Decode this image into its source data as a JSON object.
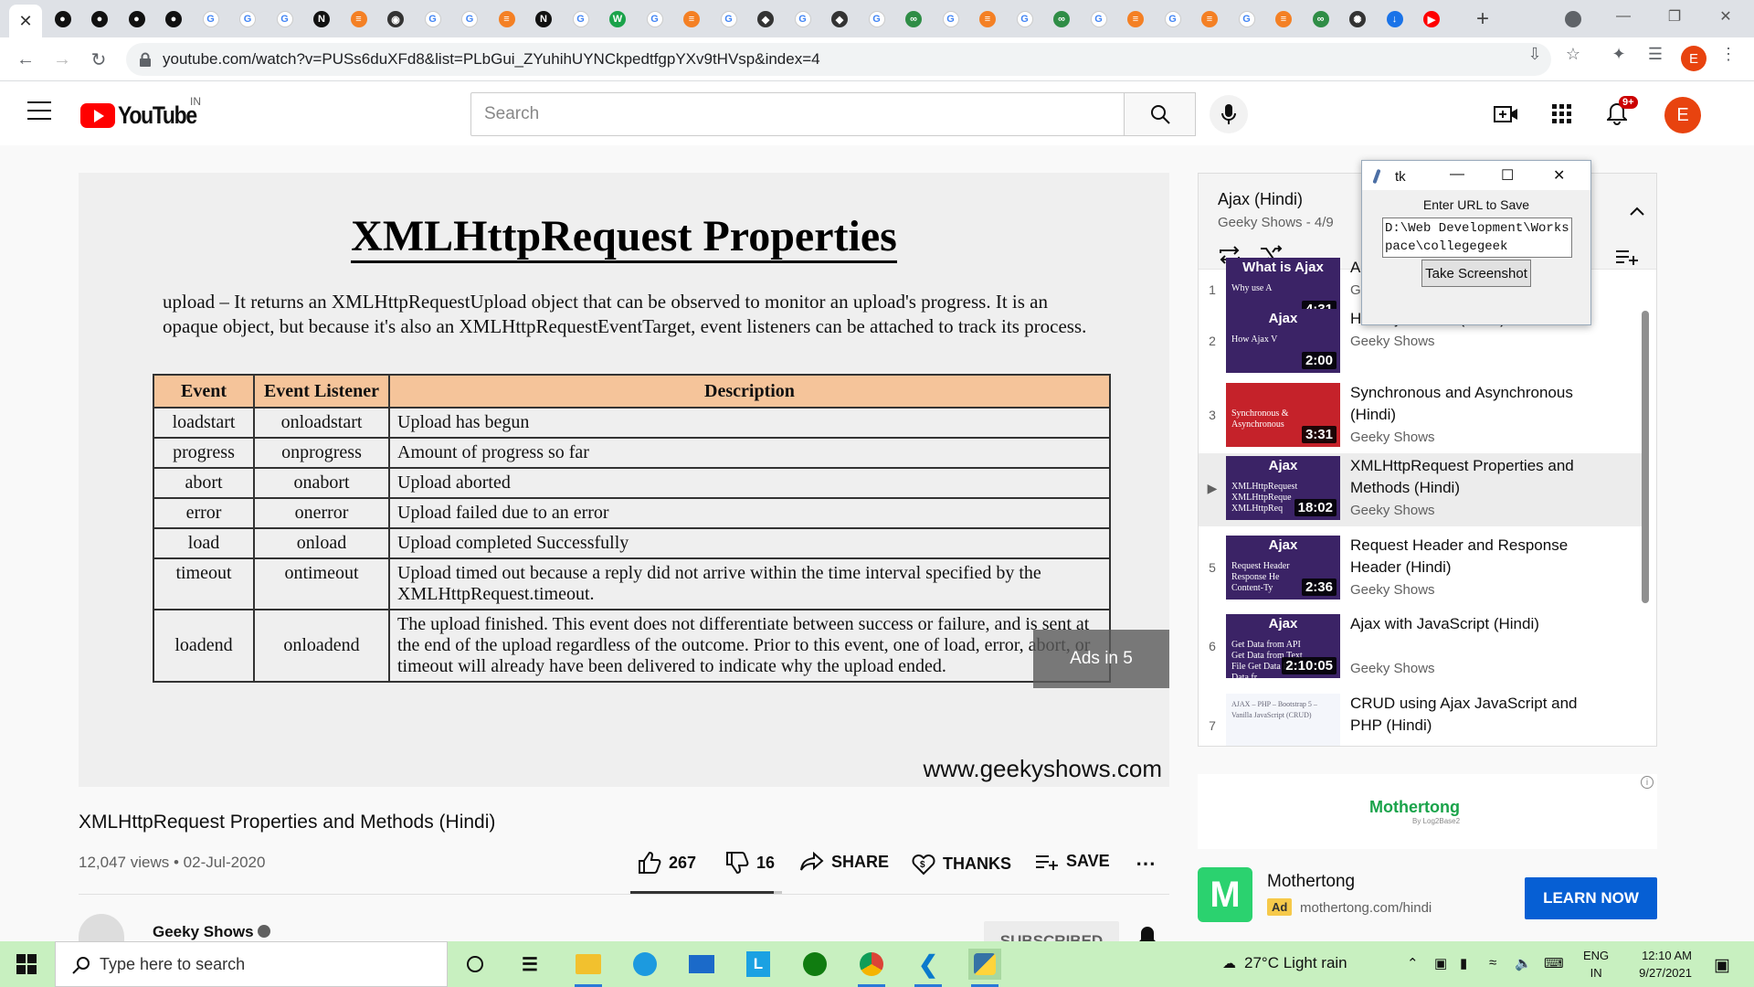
{
  "browser": {
    "tabs": [
      {
        "icon": "close-icon",
        "color": "#ffffff",
        "active": true
      },
      {
        "icon": "github-icon",
        "color": "#111111"
      },
      {
        "icon": "github-icon",
        "color": "#111111"
      },
      {
        "icon": "github-icon",
        "color": "#111111"
      },
      {
        "icon": "github-icon",
        "color": "#111111"
      },
      {
        "icon": "google-icon",
        "color": "#4285f4"
      },
      {
        "icon": "google-icon",
        "color": "#4285f4"
      },
      {
        "icon": "google-icon",
        "color": "#4285f4"
      },
      {
        "icon": "notion-icon",
        "color": "#111111"
      },
      {
        "icon": "stackoverflow-icon",
        "color": "#f48024"
      },
      {
        "icon": "web-icon",
        "color": "#333333"
      },
      {
        "icon": "google-icon",
        "color": "#4285f4"
      },
      {
        "icon": "google-icon",
        "color": "#4285f4"
      },
      {
        "icon": "stackoverflow-icon",
        "color": "#f48024"
      },
      {
        "icon": "notion-icon",
        "color": "#111111"
      },
      {
        "icon": "google-icon",
        "color": "#4285f4"
      },
      {
        "icon": "w-icon",
        "color": "#1aa34a"
      },
      {
        "icon": "google-icon",
        "color": "#4285f4"
      },
      {
        "icon": "stackoverflow-icon",
        "color": "#f48024"
      },
      {
        "icon": "google-icon",
        "color": "#4285f4"
      },
      {
        "icon": "diamond-icon",
        "color": "#333333"
      },
      {
        "icon": "google-icon",
        "color": "#4285f4"
      },
      {
        "icon": "diamond-icon",
        "color": "#333333"
      },
      {
        "icon": "google-icon",
        "color": "#4285f4"
      },
      {
        "icon": "gfg-icon",
        "color": "#2f8d46"
      },
      {
        "icon": "google-icon",
        "color": "#4285f4"
      },
      {
        "icon": "stackoverflow-icon",
        "color": "#f48024"
      },
      {
        "icon": "google-icon",
        "color": "#4285f4"
      },
      {
        "icon": "gfg-icon",
        "color": "#2f8d46"
      },
      {
        "icon": "google-icon",
        "color": "#4285f4"
      },
      {
        "icon": "stackoverflow-icon",
        "color": "#f48024"
      },
      {
        "icon": "google-icon",
        "color": "#4285f4"
      },
      {
        "icon": "stackoverflow-icon",
        "color": "#f48024"
      },
      {
        "icon": "google-icon",
        "color": "#4285f4"
      },
      {
        "icon": "stackoverflow-icon",
        "color": "#f48024"
      },
      {
        "icon": "gfg-icon",
        "color": "#2f8d46"
      },
      {
        "icon": "openai-icon",
        "color": "#333333"
      },
      {
        "icon": "download-icon",
        "color": "#1a73e8"
      },
      {
        "icon": "youtube-icon",
        "color": "#ff0000"
      }
    ],
    "url": "youtube.com/watch?v=PUSs6duXFd8&list=PLbGui_ZYuhihUYNCkpedtfgpYXv9tHVsp&index=4",
    "profile_initial": "E"
  },
  "header": {
    "logo_text": "YouTube",
    "region": "IN",
    "search_placeholder": "Search",
    "notification_count": "9+",
    "avatar_initial": "E"
  },
  "video": {
    "slide_title": "XMLHttpRequest Properties",
    "slide_paragraph": "upload – It returns an XMLHttpRequestUpload object that can be observed to monitor an upload's progress. It is an opaque object, but because it's also an XMLHttpRequestEventTarget, event listeners can be attached to track its process.",
    "table_headers": [
      "Event",
      "Event Listener",
      "Description"
    ],
    "table_rows": [
      [
        "loadstart",
        "onloadstart",
        "Upload has begun"
      ],
      [
        "progress",
        "onprogress",
        "Amount of progress so far"
      ],
      [
        "abort",
        "onabort",
        "Upload aborted"
      ],
      [
        "error",
        "onerror",
        "Upload failed due to an error"
      ],
      [
        "load",
        "onload",
        "Upload completed Successfully"
      ],
      [
        "timeout",
        "ontimeout",
        "Upload timed out because a reply did not arrive within the time interval specified by the XMLHttpRequest.timeout."
      ],
      [
        "loadend",
        "onloadend",
        "The upload finished. This event does not differentiate between success or failure, and is sent at the end of the upload regardless of the outcome. Prior to this event, one of load, error, abort, or timeout will already have been delivered to indicate why the upload ended."
      ]
    ],
    "ads_text": "Ads in 5",
    "watermark": "www.geekyshows.com",
    "title": "XMLHttpRequest Properties and Methods (Hindi)",
    "views": "12,047 views",
    "date": "02-Jul-2020",
    "likes": "267",
    "dislikes": "16",
    "like_ratio": 0.943,
    "share_label": "SHARE",
    "thanks_label": "THANKS",
    "save_label": "SAVE",
    "channel_name": "Geeky Shows",
    "subscribe_label": "SUBSCRIBED"
  },
  "playlist": {
    "title": "Ajax (Hindi)",
    "subtitle": "Geeky Shows - 4/9",
    "items": [
      {
        "num": "1",
        "title": "A",
        "channel": "G",
        "duration": "4:31",
        "thumb_head": "What is Ajax",
        "thumb_sub": "Why use A",
        "thumb_color": "#3b2366"
      },
      {
        "num": "2",
        "title": "How Ajax Work (Hindi)",
        "channel": "Geeky Shows",
        "duration": "2:00",
        "thumb_head": "Ajax",
        "thumb_sub": "How Ajax V",
        "thumb_color": "#3b2366"
      },
      {
        "num": "3",
        "title": "Synchronous and Asynchronous (Hindi)",
        "channel": "Geeky Shows",
        "duration": "3:31",
        "thumb_head": "",
        "thumb_sub": "Synchronous & Asynchronous",
        "thumb_color": "#c5222a"
      },
      {
        "num": "▶",
        "title": "XMLHttpRequest Properties and Methods (Hindi)",
        "channel": "Geeky Shows",
        "duration": "18:02",
        "thumb_head": "Ajax",
        "thumb_sub": "XMLHttpRequest XMLHttpReque XMLHttpReq",
        "thumb_color": "#3b2366",
        "active": true
      },
      {
        "num": "5",
        "title": "Request Header and Response Header (Hindi)",
        "channel": "Geeky Shows",
        "duration": "2:36",
        "thumb_head": "Ajax",
        "thumb_sub": "Request Header Response He Content-Ty",
        "thumb_color": "#3b2366"
      },
      {
        "num": "6",
        "title": "Ajax with JavaScript (Hindi)",
        "channel": "Geeky Shows",
        "duration": "2:10:05",
        "thumb_head": "Ajax",
        "thumb_sub": "Get Data from API Get Data from Text File Get Data fr Get Data fr",
        "thumb_color": "#3b2366"
      },
      {
        "num": "7",
        "title": "CRUD using Ajax JavaScript and PHP (Hindi)",
        "channel": "",
        "duration": "",
        "thumb_head": "",
        "thumb_sub": "AJAX – PHP – Bootstrap 5 – Vanilla JavaScript (CRUD)",
        "thumb_color": "#f4f6fb"
      }
    ]
  },
  "tk_window": {
    "title": "tk",
    "label": "Enter URL to Save",
    "entry_value": "D:\\Web Development\\Workspace\\collegegeek",
    "button_label": "Take Screenshot"
  },
  "ad": {
    "banner_brand": "Mothertong",
    "banner_sub": "By Log2Base2",
    "name": "Mothertong",
    "badge": "Ad",
    "url": "mothertong.com/hindi",
    "cta": "LEARN NOW",
    "logo_letter": "M"
  },
  "taskbar": {
    "search_placeholder": "Type here to search",
    "weather": "27°C  Light rain",
    "lang_line1": "ENG",
    "lang_line2": "IN",
    "time": "12:10 AM",
    "date": "9/27/2021"
  }
}
